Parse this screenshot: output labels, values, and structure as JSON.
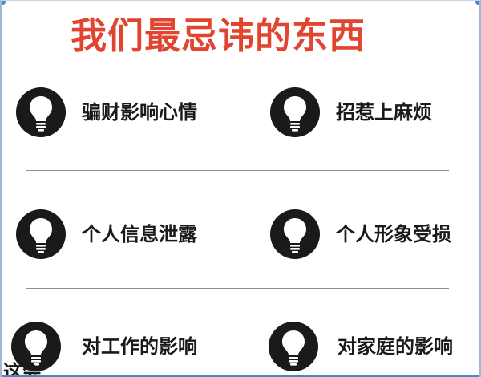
{
  "title": "我们最忌讳的东西",
  "items": [
    {
      "label": "骗财影响心情"
    },
    {
      "label": "招惹上麻烦"
    },
    {
      "label": "个人信息泄露"
    },
    {
      "label": "个人形象受损"
    },
    {
      "label": "对工作的影响"
    },
    {
      "label": "对家庭的影响"
    }
  ],
  "bottom_fragment": "这会",
  "colors": {
    "title": "#e1452f",
    "icon": "#1a1a1a",
    "text": "#1a1a1a",
    "divider": "#8e8e8e",
    "frame": "#4a86c8"
  },
  "icon_name": "lightbulb-icon"
}
